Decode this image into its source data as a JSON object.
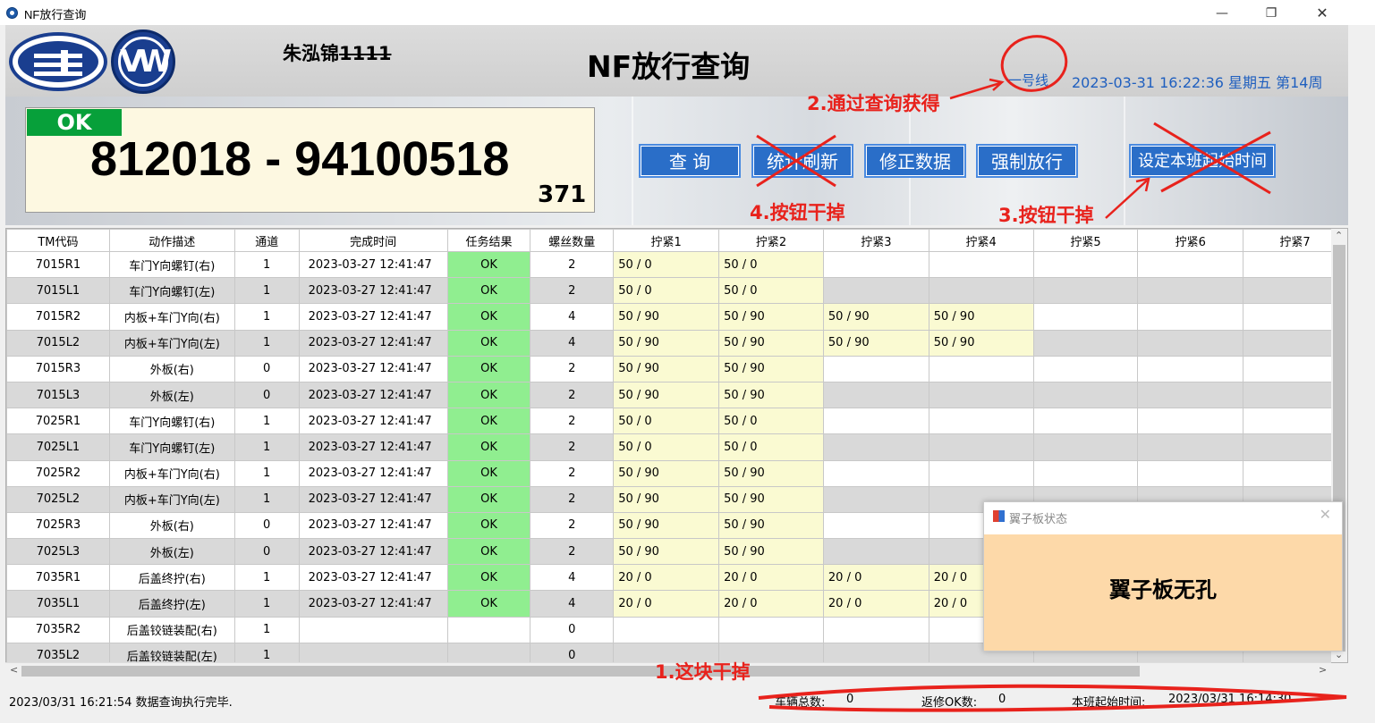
{
  "window": {
    "title": "NF放行查询",
    "min_glyph": "—",
    "max_glyph": "❐",
    "close_glyph": "✕"
  },
  "header": {
    "operator_name": "朱泓锦",
    "operator_id": "1111",
    "app_title": "NF放行查询",
    "line_name": "一号线",
    "datetime": "2023-03-31 16:22:36 星期五 第14周",
    "faw_logo_text": "一",
    "vw_logo_text": "VW"
  },
  "result": {
    "status": "OK",
    "serial": "812018 - 94100518",
    "count": "371"
  },
  "buttons": {
    "query": "查 询",
    "stats_refresh": "统计刷新",
    "fix_data": "修正数据",
    "force_release": "强制放行",
    "set_shift_time": "设定本班起始时间"
  },
  "colors": {
    "ok_green": "#07a03a",
    "grid_ok": "#90ee90",
    "torque_cell": "#fafad2",
    "button_blue": "#2a6ec8",
    "annotation_red": "#e8221c"
  },
  "table": {
    "headers": [
      "TM代码",
      "动作描述",
      "通道",
      "完成时间",
      "任务结果",
      "螺丝数量",
      "拧紧1",
      "拧紧2",
      "拧紧3",
      "拧紧4",
      "拧紧5",
      "拧紧6",
      "拧紧7"
    ],
    "rows": [
      [
        "7015R1",
        "车门Y向螺钉(右)",
        "1",
        "2023-03-27 12:41:47",
        "OK",
        "2",
        "50 / 0",
        "50 / 0",
        "",
        "",
        "",
        "",
        ""
      ],
      [
        "7015L1",
        "车门Y向螺钉(左)",
        "1",
        "2023-03-27 12:41:47",
        "OK",
        "2",
        "50 / 0",
        "50 / 0",
        "",
        "",
        "",
        "",
        ""
      ],
      [
        "7015R2",
        "内板+车门Y向(右)",
        "1",
        "2023-03-27 12:41:47",
        "OK",
        "4",
        "50 / 90",
        "50 / 90",
        "50 / 90",
        "50 / 90",
        "",
        "",
        ""
      ],
      [
        "7015L2",
        "内板+车门Y向(左)",
        "1",
        "2023-03-27 12:41:47",
        "OK",
        "4",
        "50 / 90",
        "50 / 90",
        "50 / 90",
        "50 / 90",
        "",
        "",
        ""
      ],
      [
        "7015R3",
        "外板(右)",
        "0",
        "2023-03-27 12:41:47",
        "OK",
        "2",
        "50 / 90",
        "50 / 90",
        "",
        "",
        "",
        "",
        ""
      ],
      [
        "7015L3",
        "外板(左)",
        "0",
        "2023-03-27 12:41:47",
        "OK",
        "2",
        "50 / 90",
        "50 / 90",
        "",
        "",
        "",
        "",
        ""
      ],
      [
        "7025R1",
        "车门Y向螺钉(右)",
        "1",
        "2023-03-27 12:41:47",
        "OK",
        "2",
        "50 / 0",
        "50 / 0",
        "",
        "",
        "",
        "",
        ""
      ],
      [
        "7025L1",
        "车门Y向螺钉(左)",
        "1",
        "2023-03-27 12:41:47",
        "OK",
        "2",
        "50 / 0",
        "50 / 0",
        "",
        "",
        "",
        "",
        ""
      ],
      [
        "7025R2",
        "内板+车门Y向(右)",
        "1",
        "2023-03-27 12:41:47",
        "OK",
        "2",
        "50 / 90",
        "50 / 90",
        "",
        "",
        "",
        "",
        ""
      ],
      [
        "7025L2",
        "内板+车门Y向(左)",
        "1",
        "2023-03-27 12:41:47",
        "OK",
        "2",
        "50 / 90",
        "50 / 90",
        "",
        "",
        "",
        "",
        ""
      ],
      [
        "7025R3",
        "外板(右)",
        "0",
        "2023-03-27 12:41:47",
        "OK",
        "2",
        "50 / 90",
        "50 / 90",
        "",
        "",
        "",
        "",
        ""
      ],
      [
        "7025L3",
        "外板(左)",
        "0",
        "2023-03-27 12:41:47",
        "OK",
        "2",
        "50 / 90",
        "50 / 90",
        "",
        "",
        "",
        "",
        ""
      ],
      [
        "7035R1",
        "后盖终拧(右)",
        "1",
        "2023-03-27 12:41:47",
        "OK",
        "4",
        "20 / 0",
        "20 / 0",
        "20 / 0",
        "20 / 0",
        "",
        "",
        ""
      ],
      [
        "7035L1",
        "后盖终拧(左)",
        "1",
        "2023-03-27 12:41:47",
        "OK",
        "4",
        "20 / 0",
        "20 / 0",
        "20 / 0",
        "20 / 0",
        "",
        "",
        ""
      ],
      [
        "7035R2",
        "后盖铰链装配(右)",
        "1",
        "",
        "",
        "0",
        "",
        "",
        "",
        "",
        "",
        "",
        ""
      ],
      [
        "7035L2",
        "后盖铰链装配(左)",
        "1",
        "",
        "",
        "0",
        "",
        "",
        "",
        "",
        "",
        "",
        ""
      ]
    ]
  },
  "popup": {
    "title": "翼子板状态",
    "message": "翼子板无孔",
    "close_glyph": "✕"
  },
  "scroll": {
    "up": "⌃",
    "down": "⌄",
    "left": "<",
    "right": ">"
  },
  "statusbar": {
    "message": "2023/03/31 16:21:54   数据查询执行完毕.",
    "car_count_label": "车辆总数:",
    "car_count": "0",
    "repair_ok_label": "返修OK数:",
    "repair_ok": "0",
    "shift_start_label": "本班起始时间:",
    "shift_start": "2023/03/31 16:14:30"
  },
  "annotations": {
    "a1": "1.这块干掉",
    "a2": "2.通过查询获得",
    "a3": "3.按钮干掉",
    "a4": "4.按钮干掉"
  }
}
